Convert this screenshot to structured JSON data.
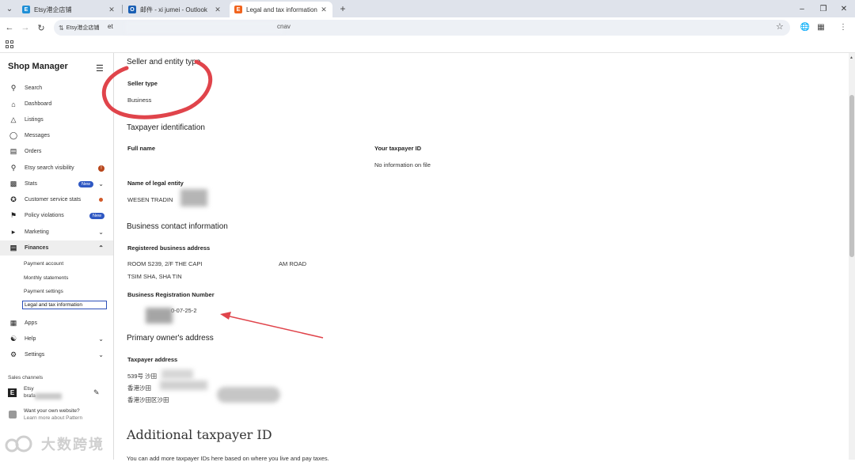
{
  "browser": {
    "tabs": [
      {
        "title": "Etsy港企店铺",
        "favicon_color": "#1f8fd6",
        "favicon_glyph": "E"
      },
      {
        "title": "邮件 - xi jumei - Outlook",
        "favicon_color": "#1a5fb4",
        "favicon_glyph": "O"
      },
      {
        "title": "Legal and tax information",
        "favicon_color": "#f1641e",
        "favicon_glyph": "E"
      }
    ],
    "active_tab_index": 2,
    "site_chip": "Etsy港企店铺",
    "url_start": "et",
    "url_end": "cnav"
  },
  "sidebar": {
    "title": "Shop Manager",
    "items": [
      {
        "label": "Search",
        "icon": "search-icon"
      },
      {
        "label": "Dashboard",
        "icon": "home-icon"
      },
      {
        "label": "Listings",
        "icon": "shapes-icon"
      },
      {
        "label": "Messages",
        "icon": "chat-icon"
      },
      {
        "label": "Orders",
        "icon": "clipboard-icon"
      },
      {
        "label": "Etsy search visibility",
        "icon": "magnify-icon",
        "alert": "!"
      },
      {
        "label": "Stats",
        "icon": "bar-chart-icon",
        "badge": "New"
      },
      {
        "label": "Customer service stats",
        "icon": "star-badge-icon"
      },
      {
        "label": "Policy violations",
        "icon": "flag-icon",
        "badge": "New"
      },
      {
        "label": "Marketing",
        "icon": "megaphone-icon"
      },
      {
        "label": "Finances",
        "icon": "bank-icon"
      }
    ],
    "finance_sub": [
      "Payment account",
      "Monthly statements",
      "Payment settings",
      "Legal and tax information"
    ],
    "bottom_items": [
      {
        "label": "Apps",
        "icon": "apps-icon"
      },
      {
        "label": "Help",
        "icon": "help-icon"
      },
      {
        "label": "Settings",
        "icon": "gear-icon"
      }
    ],
    "sales_channels_label": "Sales channels",
    "etsy_channel": "Etsy",
    "etsy_shop_prefix": "brafa",
    "pattern_line1": "Want your own website?",
    "pattern_line2": "Learn more about Pattern"
  },
  "main": {
    "seller_section_title": "Seller and entity type",
    "seller_type_label": "Seller type",
    "seller_type_value": "Business",
    "taxpayer_title": "Taxpayer identification",
    "full_name_label": "Full name",
    "taxpayer_id_label": "Your taxpayer ID",
    "taxpayer_id_value": "No information on file",
    "legal_entity_label": "Name of legal entity",
    "legal_entity_value": "WESEN TRADIN",
    "business_contact_title": "Business contact information",
    "registered_address_label": "Registered business address",
    "address_line1_a": "ROOM S239, 2/F THE CAPI",
    "address_line1_b": "AM ROAD",
    "address_line2": "TSIM SHA, SHA TIN",
    "brn_label": "Business Registration Number",
    "brn_value": "0-07-25-2",
    "primary_owner_title": "Primary owner's address",
    "taxpayer_address_label": "Taxpayer address",
    "taxpayer_address_line1": "539号 沙田",
    "taxpayer_address_line2": "香港沙田",
    "taxpayer_address_line3": "香港沙田区沙田",
    "additional_title": "Additional taxpayer ID",
    "additional_text": "You can add more taxpayer IDs here based on where you live and pay taxes."
  },
  "watermark_text": "大数跨境",
  "annotation_color": "#e0444b"
}
